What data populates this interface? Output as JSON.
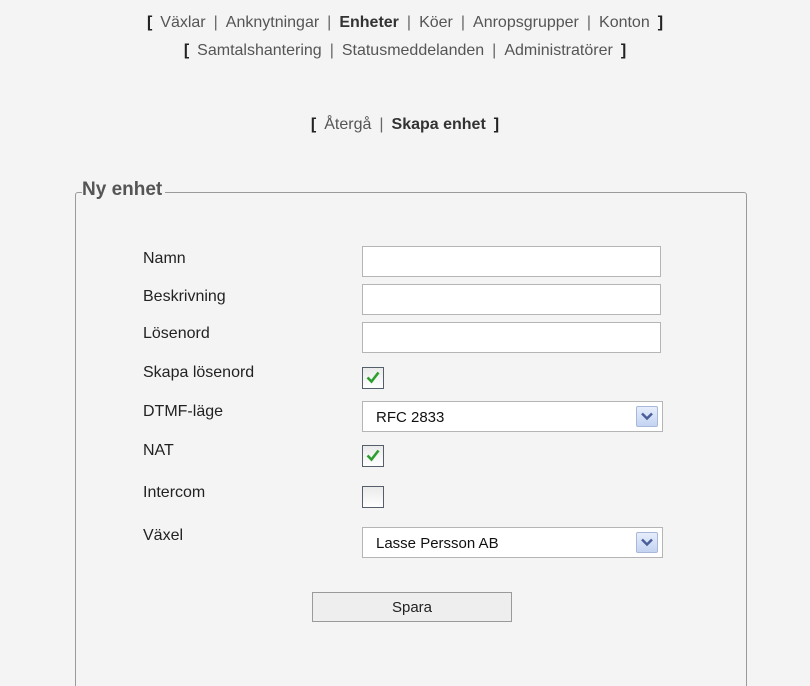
{
  "nav": {
    "primary": [
      {
        "label": "Växlar",
        "active": false
      },
      {
        "label": "Anknytningar",
        "active": false
      },
      {
        "label": "Enheter",
        "active": true
      },
      {
        "label": "Köer",
        "active": false
      },
      {
        "label": "Anropsgrupper",
        "active": false
      },
      {
        "label": "Konton",
        "active": false
      }
    ],
    "secondary": [
      {
        "label": "Samtalshantering"
      },
      {
        "label": "Statusmeddelanden"
      },
      {
        "label": "Administratörer"
      }
    ],
    "bracket_open": "[",
    "bracket_close": "]",
    "separator": "|"
  },
  "subnav": {
    "back_label": "Återgå",
    "create_label": "Skapa enhet"
  },
  "form": {
    "legend": "Ny enhet",
    "name": {
      "label": "Namn",
      "value": ""
    },
    "description": {
      "label": "Beskrivning",
      "value": ""
    },
    "password": {
      "label": "Lösenord",
      "value": ""
    },
    "create_password": {
      "label": "Skapa lösenord",
      "checked": true
    },
    "dtmf_mode": {
      "label": "DTMF-läge",
      "value": "RFC 2833"
    },
    "nat": {
      "label": "NAT",
      "checked": true
    },
    "intercom": {
      "label": "Intercom",
      "checked": false
    },
    "exchange": {
      "label": "Växel",
      "value": "Lasse Persson AB"
    },
    "save_label": "Spara"
  },
  "colors": {
    "background": "#f4f4f4",
    "checkmark": "#2e9e2e",
    "select_arrow": "#4a5f9a"
  },
  "icons": {
    "checkmark": "checkmark-icon",
    "dropdown": "chevron-down-icon"
  }
}
